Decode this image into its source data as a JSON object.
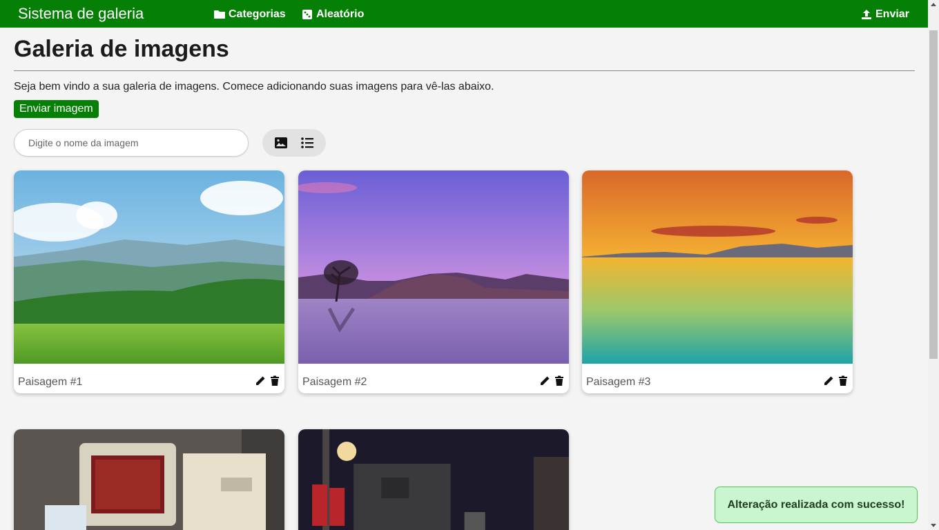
{
  "navbar": {
    "brand": "Sistema de galeria",
    "categories_label": "Categorias",
    "random_label": "Aleatório",
    "upload_label": "Enviar",
    "color": "#067f06"
  },
  "main": {
    "title": "Galeria de imagens",
    "intro": "Seja bem vindo a sua galeria de imagens. Comece adicionando suas imagens para vê-las abaixo.",
    "upload_button": "Enviar imagem",
    "search_placeholder": "Digite o nome da imagem",
    "view_modes": [
      "image-grid-icon",
      "list-icon"
    ]
  },
  "gallery": {
    "items": [
      {
        "title": "Paisagem #1",
        "scene": "green-hills-sky"
      },
      {
        "title": "Paisagem #2",
        "scene": "purple-lake-tree"
      },
      {
        "title": "Paisagem #3",
        "scene": "orange-sunset-sea"
      },
      {
        "title": "",
        "scene": "retro-computer"
      },
      {
        "title": "",
        "scene": "night-street"
      }
    ],
    "action_icons": [
      "pencil-icon",
      "trash-icon"
    ]
  },
  "toast": {
    "message": "Alteração realizada com sucesso!"
  }
}
